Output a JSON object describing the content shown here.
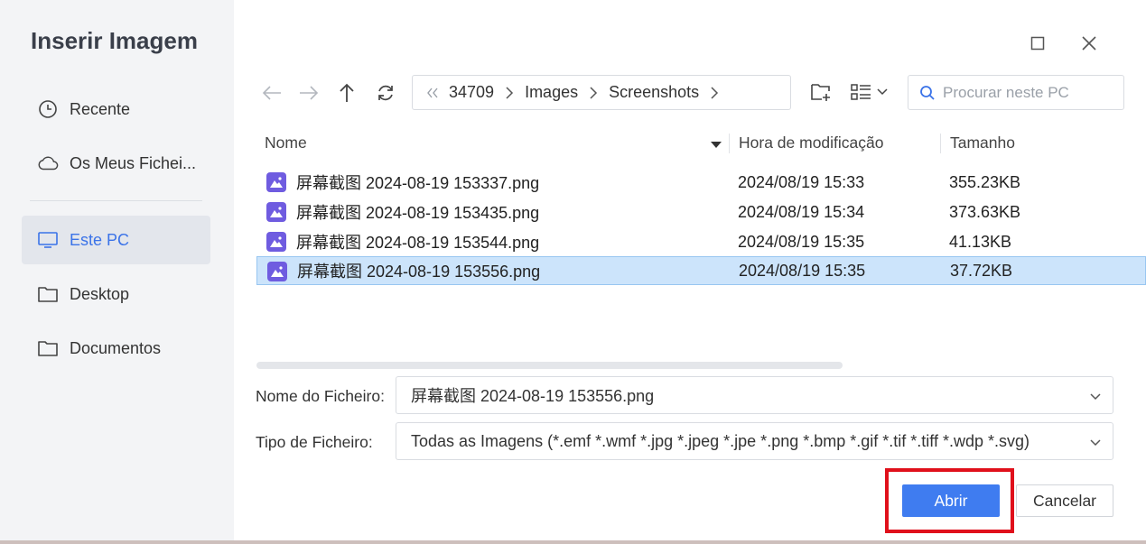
{
  "dialog": {
    "title": "Inserir Imagem"
  },
  "sidebar": {
    "items": [
      {
        "label": "Recente",
        "icon": "clock-icon"
      },
      {
        "label": "Os Meus Fichei...",
        "icon": "cloud-icon"
      },
      {
        "label": "Este PC",
        "icon": "monitor-icon",
        "active": true
      },
      {
        "label": "Desktop",
        "icon": "folder-icon"
      },
      {
        "label": "Documentos",
        "icon": "folder-icon"
      }
    ]
  },
  "toolbar": {
    "breadcrumb": [
      "34709",
      "Images",
      "Screenshots"
    ],
    "search_placeholder": "Procurar neste PC"
  },
  "file_list": {
    "columns": {
      "name": "Nome",
      "modified": "Hora de modificação",
      "size": "Tamanho"
    },
    "rows": [
      {
        "name": "屏幕截图 2024-08-19 153337.png",
        "modified": "2024/08/19 15:33",
        "size": "355.23KB"
      },
      {
        "name": "屏幕截图 2024-08-19 153435.png",
        "modified": "2024/08/19 15:34",
        "size": "373.63KB"
      },
      {
        "name": "屏幕截图 2024-08-19 153544.png",
        "modified": "2024/08/19 15:35",
        "size": "41.13KB"
      },
      {
        "name": "屏幕截图 2024-08-19 153556.png",
        "modified": "2024/08/19 15:35",
        "size": "37.72KB",
        "selected": true
      }
    ]
  },
  "footer": {
    "filename_label": "Nome do Ficheiro:",
    "filename_value": "屏幕截图 2024-08-19 153556.png",
    "filetype_label": "Tipo de Ficheiro:",
    "filetype_value": "Todas as Imagens (*.emf *.wmf *.jpg *.jpeg *.jpe *.png *.bmp *.gif *.tif *.tiff *.wdp *.svg)",
    "open_label": "Abrir",
    "cancel_label": "Cancelar"
  },
  "colors": {
    "accent": "#3f7cf0",
    "selection": "#cce4fb",
    "highlight": "#e0101b"
  }
}
